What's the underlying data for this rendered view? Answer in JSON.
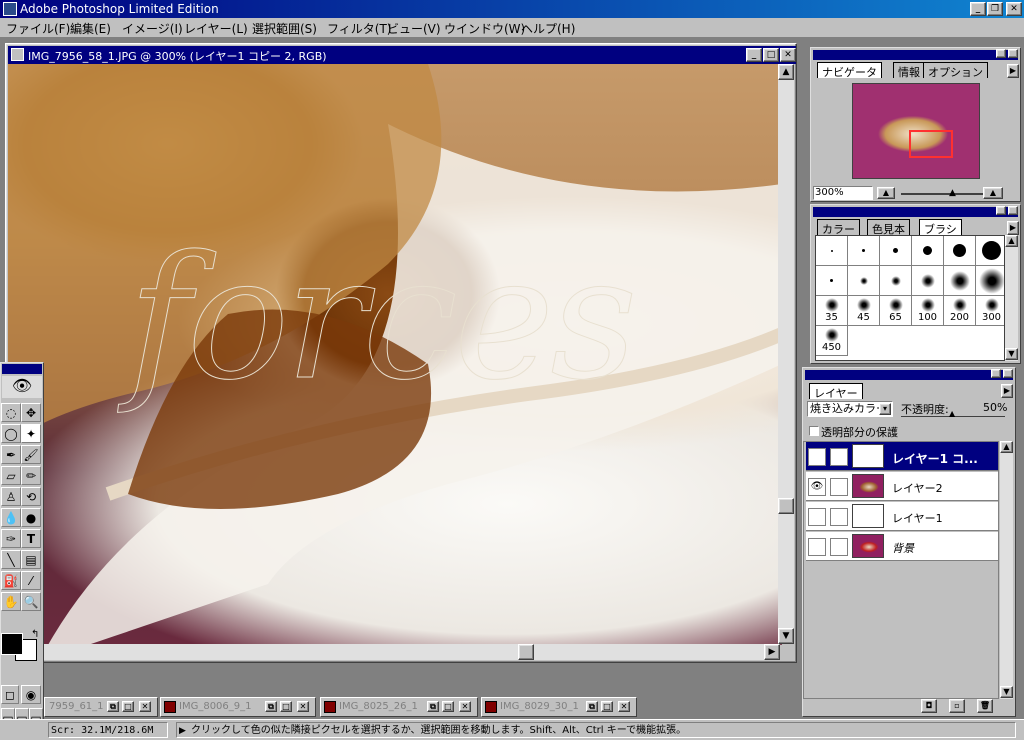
{
  "app": {
    "title": "Adobe Photoshop Limited Edition"
  },
  "menu": [
    "ファイル(F)",
    "編集(E)",
    "イメージ(I)",
    "レイヤー(L)",
    "選択範囲(S)",
    "フィルタ(T)",
    "ビュー(V)",
    "ウインドウ(W)",
    "ヘルプ(H)"
  ],
  "document": {
    "title": "IMG_7956_58_1.JPG @ 300% (レイヤー1 コピー 2, RGB)",
    "watermark": "forces"
  },
  "navigator": {
    "tabs": [
      "ナビゲータ",
      "情報",
      "オプション"
    ],
    "zoom": "300%"
  },
  "brushes": {
    "tabs": [
      "カラー",
      "色見本",
      "ブラシ"
    ],
    "labels": [
      "35",
      "45",
      "65",
      "100",
      "200",
      "300",
      "450"
    ]
  },
  "layers": {
    "tab": "レイヤー",
    "blend_mode": "焼き込みカラー",
    "opacity_label": "不透明度:",
    "opacity_value": "50%",
    "preserve_label": "透明部分の保護",
    "items": [
      {
        "name": "レイヤー1 コ..."
      },
      {
        "name": "レイヤー2"
      },
      {
        "name": "レイヤー1"
      },
      {
        "name": "背景"
      }
    ]
  },
  "minimized_windows": [
    "7959_61_1",
    "IMG_8006_9_1",
    "IMG_8025_26_1",
    "IMG_8029_30_1"
  ],
  "status": {
    "scratch": "Scr: 32.1M/218.6M",
    "message": "クリックして色の似た隣接ピクセルを選択するか、選択範囲を移動します。Shift、Alt、Ctrl キーで機能拡張。"
  },
  "colors": {
    "titlebar": "#000080",
    "chrome": "#c0c0c0",
    "selected_layer": "#000080",
    "nav_box": "#ff3030"
  }
}
